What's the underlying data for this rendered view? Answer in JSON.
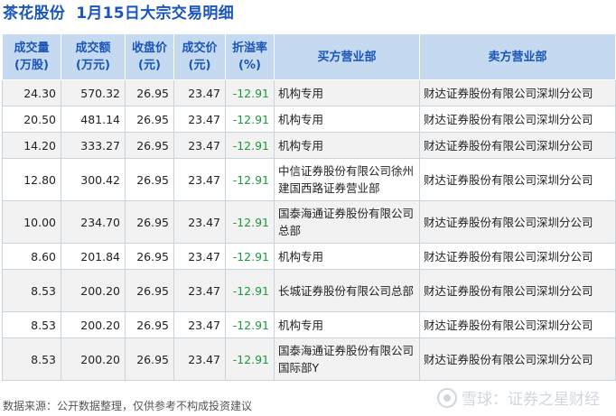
{
  "title": {
    "stock_name": "茶花股份",
    "subtitle": "1月15日大宗交易明细"
  },
  "columns": [
    [
      "成交量",
      "(万股)"
    ],
    [
      "成交额",
      "(万元)"
    ],
    [
      "收盘价",
      "(元)"
    ],
    [
      "成交价",
      "(元)"
    ],
    [
      "折溢率",
      "(%)"
    ],
    [
      "买方营业部"
    ],
    [
      "卖方营业部"
    ]
  ],
  "rows": [
    {
      "volume": "24.30",
      "amount": "570.32",
      "close": "26.95",
      "price": "23.47",
      "premium": "-12.91",
      "buyer": "机构专用",
      "seller": "财达证券股份有限公司深圳分公司"
    },
    {
      "volume": "20.50",
      "amount": "481.14",
      "close": "26.95",
      "price": "23.47",
      "premium": "-12.91",
      "buyer": "机构专用",
      "seller": "财达证券股份有限公司深圳分公司"
    },
    {
      "volume": "14.20",
      "amount": "333.27",
      "close": "26.95",
      "price": "23.47",
      "premium": "-12.91",
      "buyer": "机构专用",
      "seller": "财达证券股份有限公司深圳分公司"
    },
    {
      "volume": "12.80",
      "amount": "300.42",
      "close": "26.95",
      "price": "23.47",
      "premium": "-12.91",
      "buyer": "中信证券股份有限公司徐州建国西路证券营业部",
      "seller": "财达证券股份有限公司深圳分公司"
    },
    {
      "volume": "10.00",
      "amount": "234.70",
      "close": "26.95",
      "price": "23.47",
      "premium": "-12.91",
      "buyer": "国泰海通证券股份有限公司总部",
      "seller": "财达证券股份有限公司深圳分公司"
    },
    {
      "volume": "8.60",
      "amount": "201.84",
      "close": "26.95",
      "price": "23.47",
      "premium": "-12.91",
      "buyer": "机构专用",
      "seller": "财达证券股份有限公司深圳分公司"
    },
    {
      "volume": "8.53",
      "amount": "200.20",
      "close": "26.95",
      "price": "23.47",
      "premium": "-12.91",
      "buyer": "长城证券股份有限公司总部",
      "seller": "财达证券股份有限公司深圳分公司"
    },
    {
      "volume": "8.53",
      "amount": "200.20",
      "close": "26.95",
      "price": "23.47",
      "premium": "-12.91",
      "buyer": "机构专用",
      "seller": "财达证券股份有限公司深圳分公司"
    },
    {
      "volume": "8.53",
      "amount": "200.20",
      "close": "26.95",
      "price": "23.47",
      "premium": "-12.91",
      "buyer": "国泰海通证券股份有限公司国际部Y",
      "seller": "财达证券股份有限公司深圳分公司"
    }
  ],
  "footer": "数据来源：公开数据整理，仅供参考不构成投资建议",
  "brand": "雪球：证券之星财经",
  "colors": {
    "title": "#1a56b8",
    "header_bg": "#c5d9f1",
    "negative": "#1a9a3a"
  }
}
